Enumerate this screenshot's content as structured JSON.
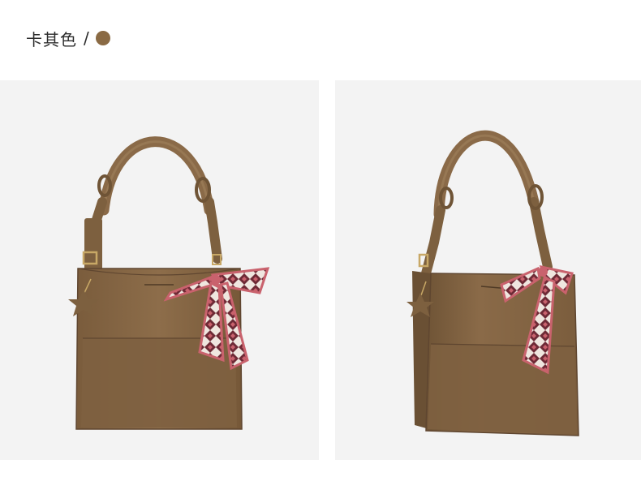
{
  "header": {
    "color_name": "卡其色",
    "separator": "/"
  },
  "colors": {
    "swatch": "#8a6a44",
    "bag_body": "#8a6a48",
    "bag_dark": "#6f5436",
    "bag_light": "#9a7a56",
    "panel_bg": "#f3f3f3",
    "scarf_pink": "#c9626d",
    "scarf_wine": "#6e2a36",
    "scarf_cream": "#efe6df",
    "hardware": "#c8a866"
  },
  "product_views": [
    {
      "name": "front-view",
      "description_icon": "bag-photo"
    },
    {
      "name": "angled-view",
      "description_icon": "bag-photo"
    }
  ]
}
